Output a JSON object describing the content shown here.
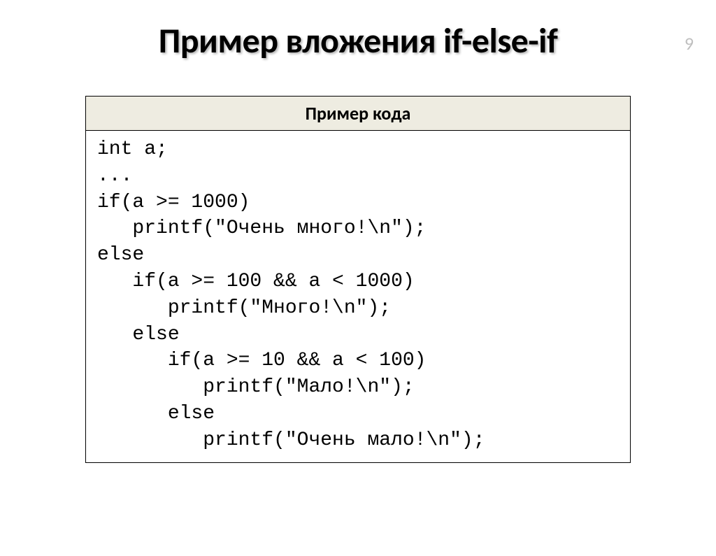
{
  "page_number": "9",
  "title": "Пример вложения if-else-if",
  "table": {
    "header": "Пример кода",
    "code": "int a;\n...\nif(a >= 1000)\n   printf(\"Очень много!\\n\");\nelse\n   if(a >= 100 && a < 1000)\n      printf(\"Много!\\n\");\n   else\n      if(a >= 10 && a < 100)\n         printf(\"Мало!\\n\");\n      else\n         printf(\"Очень мало!\\n\");"
  }
}
